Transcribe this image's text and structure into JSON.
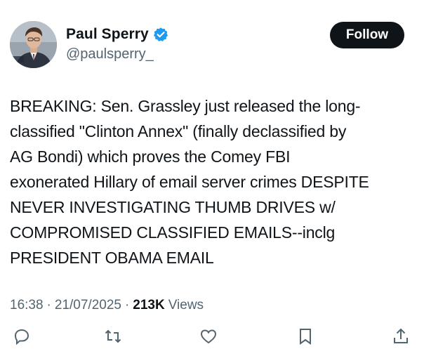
{
  "author": {
    "display_name": "Paul Sperry",
    "handle": "@paulsperry_",
    "verified": true,
    "avatar_icon": "profile-photo"
  },
  "follow_button": {
    "label": "Follow"
  },
  "tweet": {
    "text": "BREAKING: Sen. Grassley just released the long-\nclassified \"Clinton Annex\" (finally declassified by\nAG Bondi) which proves the Comey FBI\nexonerated Hillary of email server crimes DESPITE\nNEVER INVESTIGATING THUMB DRIVES w/\nCOMPROMISED CLASSIFIED EMAILS--inclg\nPRESIDENT OBAMA EMAIL"
  },
  "meta": {
    "time": "16:38",
    "separator": "·",
    "date": "21/07/2025",
    "views_count": "213K",
    "views_label": "Views"
  },
  "actions": [
    {
      "icon": "reply-icon"
    },
    {
      "icon": "retweet-icon"
    },
    {
      "icon": "like-icon"
    },
    {
      "icon": "bookmark-icon"
    },
    {
      "icon": "share-icon"
    }
  ],
  "colors": {
    "text_primary": "#0f1419",
    "text_secondary": "#536471",
    "verified_blue": "#1d9bf0",
    "follow_bg": "#0f1419",
    "follow_text": "#ffffff"
  }
}
